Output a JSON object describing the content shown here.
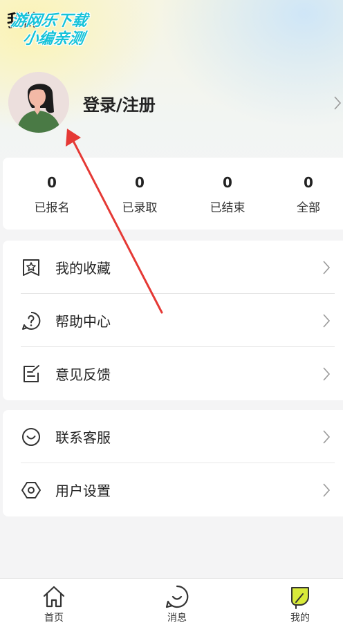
{
  "header": {
    "title": "我的",
    "watermark_line1": "游网乐下载",
    "watermark_line2": "小编亲测"
  },
  "profile": {
    "login_label": "登录/注册"
  },
  "stats": [
    {
      "value": "0",
      "label": "已报名"
    },
    {
      "value": "0",
      "label": "已录取"
    },
    {
      "value": "0",
      "label": "已结束"
    },
    {
      "value": "0",
      "label": "全部"
    }
  ],
  "menu_group1": [
    {
      "label": "我的收藏",
      "icon": "star-bookmark-icon"
    },
    {
      "label": "帮助中心",
      "icon": "help-question-icon"
    },
    {
      "label": "意见反馈",
      "icon": "feedback-edit-icon"
    }
  ],
  "menu_group2": [
    {
      "label": "联系客服",
      "icon": "customer-service-icon"
    },
    {
      "label": "用户设置",
      "icon": "settings-hexagon-icon"
    }
  ],
  "tabbar": [
    {
      "label": "首页",
      "icon": "home-icon"
    },
    {
      "label": "消息",
      "icon": "message-smile-icon"
    },
    {
      "label": "我的",
      "icon": "profile-leaf-icon"
    }
  ],
  "colors": {
    "annotation_arrow": "#e53935",
    "watermark": "#16c3d9",
    "active_tab_icon": "#d8ea3a"
  }
}
